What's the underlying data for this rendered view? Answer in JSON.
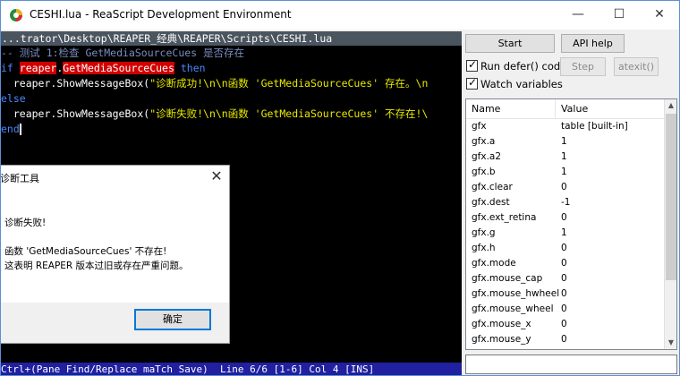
{
  "window": {
    "title": "CESHI.lua - ReaScript Development Environment",
    "minimize_glyph": "—",
    "maximize_glyph": "☐",
    "close_glyph": "✕"
  },
  "editor": {
    "path": "...trator\\Desktop\\REAPER_经典\\REAPER\\Scripts\\CESHI.lua",
    "line1_comment": "-- 测试 1:检查 GetMediaSourceCues 是否存在",
    "line2_if": "if",
    "line2_reaper": "reaper",
    "line2_dot": ".",
    "line2_func": "GetMediaSourceCues",
    "line2_then": "then",
    "line3_indent": "  ",
    "line3_call": "reaper.ShowMessageBox(",
    "line3_str": "\"诊断成功!\\n\\n函数 'GetMediaSourceCues' 存在。\\n",
    "line4_else": "else",
    "line5_indent": "  ",
    "line5_call": "reaper.ShowMessageBox(",
    "line5_str": "\"诊断失败!\\n\\n函数 'GetMediaSourceCues' 不存在!\\",
    "line6_end": "end",
    "status": "Ctrl+(Pane Find/Replace maTch Save)  Line 6/6 [1-6] Col 4 [INS]"
  },
  "dialog": {
    "title": "诊断工具",
    "close_glyph": "✕",
    "msg_line1": "诊断失败!",
    "msg_line2": "函数 'GetMediaSourceCues' 不存在!",
    "msg_line3": "这表明 REAPER 版本过旧或存在严重问题。",
    "ok_label": "确定"
  },
  "controls": {
    "start_label": "Start",
    "api_help_label": "API help",
    "run_defer_label": "Run defer() code",
    "run_defer_checked": true,
    "step_label": "Step",
    "atexit_label": "atexit()",
    "watch_vars_label": "Watch variables",
    "watch_vars_checked": true
  },
  "watch_list": {
    "headers": {
      "name": "Name",
      "value": "Value"
    },
    "rows": [
      {
        "name": "gfx",
        "value": "table [built-in]"
      },
      {
        "name": "gfx.a",
        "value": "1"
      },
      {
        "name": "gfx.a2",
        "value": "1"
      },
      {
        "name": "gfx.b",
        "value": "1"
      },
      {
        "name": "gfx.clear",
        "value": "0"
      },
      {
        "name": "gfx.dest",
        "value": "-1"
      },
      {
        "name": "gfx.ext_retina",
        "value": "0"
      },
      {
        "name": "gfx.g",
        "value": "1"
      },
      {
        "name": "gfx.h",
        "value": "0"
      },
      {
        "name": "gfx.mode",
        "value": "0"
      },
      {
        "name": "gfx.mouse_cap",
        "value": "0"
      },
      {
        "name": "gfx.mouse_hwheel",
        "value": "0"
      },
      {
        "name": "gfx.mouse_wheel",
        "value": "0"
      },
      {
        "name": "gfx.mouse_x",
        "value": "0"
      },
      {
        "name": "gfx.mouse_y",
        "value": "0"
      }
    ],
    "scroll_up_glyph": "▲",
    "scroll_down_glyph": "▼"
  }
}
